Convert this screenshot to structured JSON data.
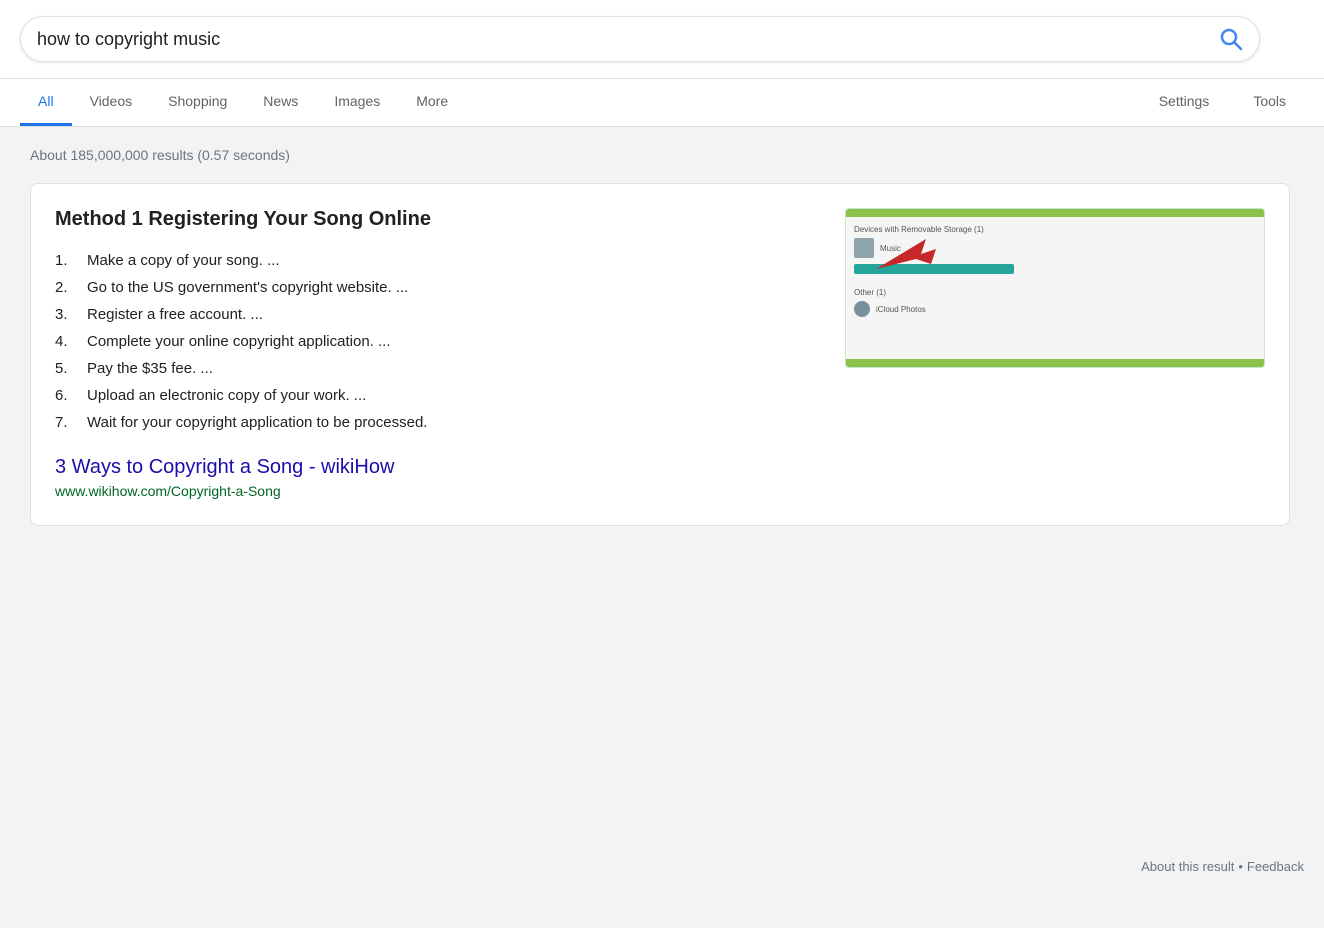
{
  "search": {
    "query": "how to copyright music",
    "placeholder": "Search"
  },
  "tabs": {
    "items": [
      {
        "label": "All",
        "active": true
      },
      {
        "label": "Videos",
        "active": false
      },
      {
        "label": "Shopping",
        "active": false
      },
      {
        "label": "News",
        "active": false
      },
      {
        "label": "Images",
        "active": false
      },
      {
        "label": "More",
        "active": false
      }
    ],
    "right_items": [
      {
        "label": "Settings"
      },
      {
        "label": "Tools"
      }
    ]
  },
  "results": {
    "info": "About 185,000,000 results (0.57 seconds)",
    "featured_snippet": {
      "title": "Method 1 Registering Your Song Online",
      "steps": [
        "Make a copy of your song. ...",
        "Go to the US government's copyright website. ...",
        "Register a free account. ...",
        "Complete your online copyright application. ...",
        "Pay the $35 fee. ...",
        "Upload an electronic copy of your work. ...",
        "Wait for your copyright application to be processed."
      ],
      "link_title": "3 Ways to Copyright a Song - wikiHow",
      "link_url": "www.wikihow.com/Copyright-a-Song"
    }
  },
  "footer": {
    "about": "About this result",
    "separator": "•",
    "feedback": "Feedback"
  }
}
